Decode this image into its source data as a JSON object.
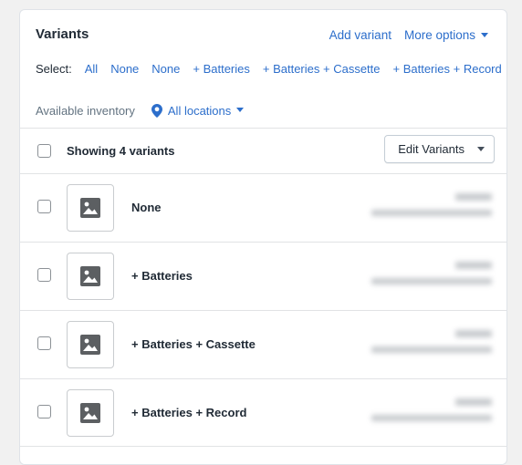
{
  "header": {
    "title": "Variants",
    "add_variant": "Add variant",
    "more_options": "More options"
  },
  "select": {
    "label": "Select:",
    "options": [
      "All",
      "None",
      "None",
      "+ Batteries",
      "+ Batteries + Cassette",
      "+ Batteries + Record"
    ]
  },
  "inventory": {
    "label": "Available inventory",
    "location": "All locations",
    "location_icon": "map-pin-icon"
  },
  "bulk": {
    "showing": "Showing 4 variants",
    "edit_button": "Edit Variants"
  },
  "variants": [
    {
      "name": "None",
      "image_icon": "image-placeholder-icon"
    },
    {
      "name": "+ Batteries",
      "image_icon": "image-placeholder-icon"
    },
    {
      "name": "+ Batteries + Cassette",
      "image_icon": "image-placeholder-icon"
    },
    {
      "name": "+ Batteries + Record",
      "image_icon": "image-placeholder-icon"
    }
  ],
  "colors": {
    "accent": "#2c6ecb",
    "text": "#212b36",
    "muted": "#637381",
    "border": "#e1e3e5"
  }
}
